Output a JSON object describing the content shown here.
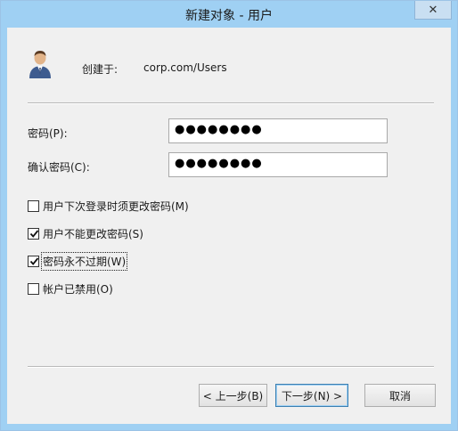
{
  "window": {
    "title": "新建对象 - 用户",
    "close_symbol": "✕"
  },
  "header": {
    "created_label": "创建于:",
    "created_value": "corp.com/Users"
  },
  "form": {
    "password_label": "密码(P):",
    "password_value": "●●●●●●●●",
    "confirm_label": "确认密码(C):",
    "confirm_value": "●●●●●●●●"
  },
  "options": [
    {
      "label": "用户下次登录时须更改密码(M)",
      "checked": false
    },
    {
      "label": "用户不能更改密码(S)",
      "checked": true
    },
    {
      "label": "密码永不过期(W)",
      "checked": true
    },
    {
      "label": "帐户已禁用(O)",
      "checked": false
    }
  ],
  "buttons": {
    "prev": "< 上一步(B)",
    "next": "下一步(N) >",
    "cancel": "取消"
  },
  "colors": {
    "titlebar": "#9fd0f3",
    "client": "#f0f0f0",
    "accent_border": "#3c7fb1"
  },
  "icons": {
    "user": "user-icon",
    "close": "close-icon",
    "check": "checkmark-icon"
  }
}
